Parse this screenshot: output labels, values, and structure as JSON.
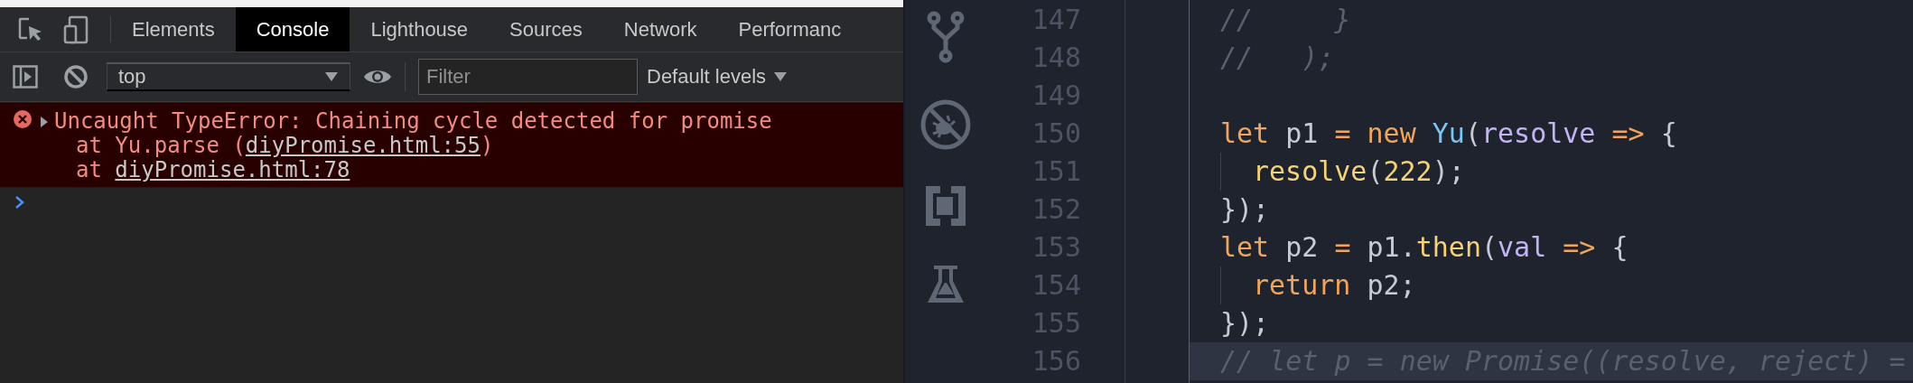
{
  "devtools": {
    "tabs": [
      {
        "label": "Elements",
        "selected": false
      },
      {
        "label": "Console",
        "selected": true
      },
      {
        "label": "Lighthouse",
        "selected": false
      },
      {
        "label": "Sources",
        "selected": false
      },
      {
        "label": "Network",
        "selected": false
      },
      {
        "label": "Performanc",
        "selected": false
      }
    ],
    "context": "top",
    "filter": {
      "placeholder": "Filter"
    },
    "levels": "Default levels",
    "messages": [
      {
        "kind": "error",
        "text": "Uncaught TypeError: Chaining cycle detected for promise",
        "stack": [
          {
            "prefix": "at Yu.parse (",
            "link": "diyPromise.html:55",
            "suffix": ")"
          },
          {
            "prefix": "at ",
            "link": "diyPromise.html:78"
          }
        ]
      }
    ]
  },
  "editor": {
    "lines": [
      {
        "number": "147",
        "indent": false,
        "highlighted": false,
        "tokens": [
          {
            "kind": "comment",
            "text": "//     }"
          }
        ]
      },
      {
        "number": "148",
        "indent": false,
        "highlighted": false,
        "tokens": [
          {
            "kind": "comment",
            "text": "//   );"
          }
        ]
      },
      {
        "number": "149",
        "indent": false,
        "highlighted": false
      },
      {
        "number": "150",
        "indent": false,
        "highlighted": false,
        "tokens": [
          {
            "kind": "keyword",
            "text": "let"
          },
          {
            "kind": "plain",
            "text": " p1 "
          },
          {
            "kind": "op",
            "text": "="
          },
          {
            "kind": "keyword",
            "text": " new"
          },
          {
            "kind": "class",
            "text": " Yu"
          },
          {
            "kind": "plain",
            "text": "("
          },
          {
            "kind": "param",
            "text": "resolve"
          },
          {
            "kind": "op",
            "text": " =>"
          },
          {
            "kind": "plain",
            "text": " {"
          }
        ]
      },
      {
        "number": "151",
        "indent": true,
        "highlighted": false,
        "tokens": [
          {
            "kind": "func",
            "text": "resolve"
          },
          {
            "kind": "plain",
            "text": "("
          },
          {
            "kind": "number",
            "text": "222"
          },
          {
            "kind": "plain",
            "text": ");"
          }
        ]
      },
      {
        "number": "152",
        "indent": false,
        "highlighted": false,
        "tokens": [
          {
            "kind": "plain",
            "text": "});"
          }
        ]
      },
      {
        "number": "153",
        "indent": false,
        "highlighted": false,
        "tokens": [
          {
            "kind": "keyword",
            "text": "let"
          },
          {
            "kind": "plain",
            "text": " p2 "
          },
          {
            "kind": "op",
            "text": "="
          },
          {
            "kind": "plain",
            "text": " p1."
          },
          {
            "kind": "func",
            "text": "then"
          },
          {
            "kind": "plain",
            "text": "("
          },
          {
            "kind": "param",
            "text": "val"
          },
          {
            "kind": "op",
            "text": " =>"
          },
          {
            "kind": "plain",
            "text": " {"
          }
        ]
      },
      {
        "number": "154",
        "indent": true,
        "highlighted": false,
        "tokens": [
          {
            "kind": "keyword",
            "text": "return"
          },
          {
            "kind": "plain",
            "text": " p2;"
          }
        ]
      },
      {
        "number": "155",
        "indent": false,
        "highlighted": false,
        "tokens": [
          {
            "kind": "plain",
            "text": "});"
          }
        ]
      },
      {
        "number": "156",
        "indent": false,
        "highlighted": true,
        "tokens": [
          {
            "kind": "comment",
            "text": "// let p = new Promise((resolve, reject) ="
          }
        ]
      }
    ]
  }
}
